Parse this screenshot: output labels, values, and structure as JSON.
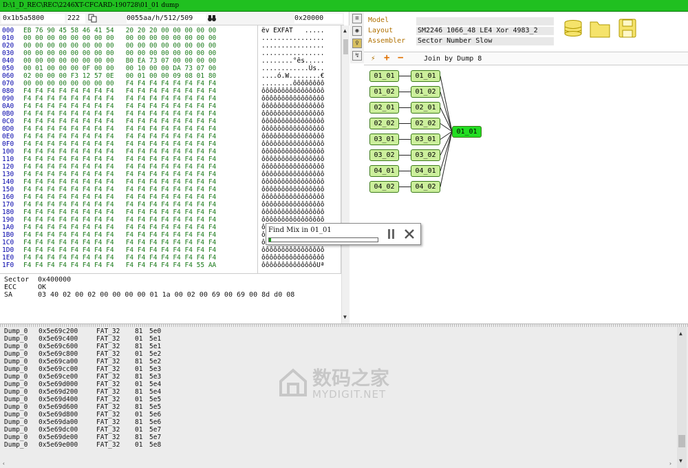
{
  "window": {
    "title": "D:\\1_D_REC\\REC\\2246XT-CFCARD-190728\\01_01 dump"
  },
  "toolbar": {
    "address": "0x1b5a5800",
    "sector_count": "222",
    "page_info": "0055aa/h/512/509",
    "offset_right": "0x20000"
  },
  "hex": {
    "rows": [
      {
        "off": "000",
        "hex": "EB 76 90 45 58 46 41 54   20 20 20 00 00 00 00 00",
        "asc": "ëv EXFAT   ....."
      },
      {
        "off": "010",
        "hex": "00 00 00 00 00 00 00 00   00 00 00 00 00 00 00 00",
        "asc": "................"
      },
      {
        "off": "020",
        "hex": "00 00 00 00 00 00 00 00   00 00 00 00 00 00 00 00",
        "asc": "................"
      },
      {
        "off": "030",
        "hex": "00 00 00 00 00 00 00 00   00 00 00 00 00 00 00 00",
        "asc": "................"
      },
      {
        "off": "040",
        "hex": "00 00 00 00 00 00 00 00   B0 EA 73 07 00 00 00 00",
        "asc": "........°ês....."
      },
      {
        "off": "050",
        "hex": "00 01 00 00 00 0F 00 00   00 10 00 00 DA 73 07 00",
        "asc": "............Ús.."
      },
      {
        "off": "060",
        "hex": "02 00 00 00 F3 12 57 0E   00 01 00 00 09 08 01 80",
        "asc": "....ó.W........€"
      },
      {
        "off": "070",
        "hex": "00 00 00 00 00 00 00 00   F4 F4 F4 F4 F4 F4 F4 F4",
        "asc": "........ôôôôôôôô"
      },
      {
        "off": "080",
        "hex": "F4 F4 F4 F4 F4 F4 F4 F4   F4 F4 F4 F4 F4 F4 F4 F4",
        "asc": "ôôôôôôôôôôôôôôôô"
      },
      {
        "off": "090",
        "hex": "F4 F4 F4 F4 F4 F4 F4 F4   F4 F4 F4 F4 F4 F4 F4 F4",
        "asc": "ôôôôôôôôôôôôôôôô"
      },
      {
        "off": "0A0",
        "hex": "F4 F4 F4 F4 F4 F4 F4 F4   F4 F4 F4 F4 F4 F4 F4 F4",
        "asc": "ôôôôôôôôôôôôôôôô"
      },
      {
        "off": "0B0",
        "hex": "F4 F4 F4 F4 F4 F4 F4 F4   F4 F4 F4 F4 F4 F4 F4 F4",
        "asc": "ôôôôôôôôôôôôôôôô"
      },
      {
        "off": "0C0",
        "hex": "F4 F4 F4 F4 F4 F4 F4 F4   F4 F4 F4 F4 F4 F4 F4 F4",
        "asc": "ôôôôôôôôôôôôôôôô"
      },
      {
        "off": "0D0",
        "hex": "F4 F4 F4 F4 F4 F4 F4 F4   F4 F4 F4 F4 F4 F4 F4 F4",
        "asc": "ôôôôôôôôôôôôôôôô"
      },
      {
        "off": "0E0",
        "hex": "F4 F4 F4 F4 F4 F4 F4 F4   F4 F4 F4 F4 F4 F4 F4 F4",
        "asc": "ôôôôôôôôôôôôôôôô"
      },
      {
        "off": "0F0",
        "hex": "F4 F4 F4 F4 F4 F4 F4 F4   F4 F4 F4 F4 F4 F4 F4 F4",
        "asc": "ôôôôôôôôôôôôôôôô"
      },
      {
        "off": "100",
        "hex": "F4 F4 F4 F4 F4 F4 F4 F4   F4 F4 F4 F4 F4 F4 F4 F4",
        "asc": "ôôôôôôôôôôôôôôôô"
      },
      {
        "off": "110",
        "hex": "F4 F4 F4 F4 F4 F4 F4 F4   F4 F4 F4 F4 F4 F4 F4 F4",
        "asc": "ôôôôôôôôôôôôôôôô"
      },
      {
        "off": "120",
        "hex": "F4 F4 F4 F4 F4 F4 F4 F4   F4 F4 F4 F4 F4 F4 F4 F4",
        "asc": "ôôôôôôôôôôôôôôôô"
      },
      {
        "off": "130",
        "hex": "F4 F4 F4 F4 F4 F4 F4 F4   F4 F4 F4 F4 F4 F4 F4 F4",
        "asc": "ôôôôôôôôôôôôôôôô"
      },
      {
        "off": "140",
        "hex": "F4 F4 F4 F4 F4 F4 F4 F4   F4 F4 F4 F4 F4 F4 F4 F4",
        "asc": "ôôôôôôôôôôôôôôôô"
      },
      {
        "off": "150",
        "hex": "F4 F4 F4 F4 F4 F4 F4 F4   F4 F4 F4 F4 F4 F4 F4 F4",
        "asc": "ôôôôôôôôôôôôôôôô"
      },
      {
        "off": "160",
        "hex": "F4 F4 F4 F4 F4 F4 F4 F4   F4 F4 F4 F4 F4 F4 F4 F4",
        "asc": "ôôôôôôôôôôôôôôôô"
      },
      {
        "off": "170",
        "hex": "F4 F4 F4 F4 F4 F4 F4 F4   F4 F4 F4 F4 F4 F4 F4 F4",
        "asc": "ôôôôôôôôôôôôôôôô"
      },
      {
        "off": "180",
        "hex": "F4 F4 F4 F4 F4 F4 F4 F4   F4 F4 F4 F4 F4 F4 F4 F4",
        "asc": "ôôôôôôôôôôôôôôôô"
      },
      {
        "off": "190",
        "hex": "F4 F4 F4 F4 F4 F4 F4 F4   F4 F4 F4 F4 F4 F4 F4 F4",
        "asc": "ôôôôôôôôôôôôôôôô"
      },
      {
        "off": "1A0",
        "hex": "F4 F4 F4 F4 F4 F4 F4 F4   F4 F4 F4 F4 F4 F4 F4 F4",
        "asc": "ôôôôôôôôôôôôôôôô"
      },
      {
        "off": "1B0",
        "hex": "F4 F4 F4 F4 F4 F4 F4 F4   F4 F4 F4 F4 F4 F4 F4 F4",
        "asc": "ôôôôôôôôôôôôôôôô"
      },
      {
        "off": "1C0",
        "hex": "F4 F4 F4 F4 F4 F4 F4 F4   F4 F4 F4 F4 F4 F4 F4 F4",
        "asc": "ôôôôôôôôôôôôôôôô"
      },
      {
        "off": "1D0",
        "hex": "F4 F4 F4 F4 F4 F4 F4 F4   F4 F4 F4 F4 F4 F4 F4 F4",
        "asc": "ôôôôôôôôôôôôôôôô"
      },
      {
        "off": "1E0",
        "hex": "F4 F4 F4 F4 F4 F4 F4 F4   F4 F4 F4 F4 F4 F4 F4 F4",
        "asc": "ôôôôôôôôôôôôôôôô"
      },
      {
        "off": "1F0",
        "hex": "F4 F4 F4 F4 F4 F4 F4 F4   F4 F4 F4 F4 F4 F4 55 AA",
        "asc": "ôôôôôôôôôôôôôôUª"
      }
    ]
  },
  "info": {
    "sector_label": "Sector",
    "sector_value": "0x400000",
    "ecc_label": "ECC",
    "ecc_value": "OK",
    "sa_label": "SA",
    "sa_value": "03 40 02 00 02 00 00 00 00 01 1a 00 02 00 69 00 69 00 8d d0 08"
  },
  "props": {
    "model_label": "Model",
    "model_value": "",
    "layout_label": "Layout",
    "layout_value": "SM2246 1066_48 LE4 Xor 4983_2",
    "assembler_label": "Assembler",
    "assembler_value": "Sector Number Slow"
  },
  "join": {
    "label": "Join by Dump 8"
  },
  "graph": {
    "left_nodes": [
      "01_01",
      "01_02",
      "02_01",
      "02_02",
      "03_01",
      "03_02",
      "04_01",
      "04_02"
    ],
    "mid_nodes": [
      "01_01",
      "01_02",
      "02_01",
      "02_02",
      "03_01",
      "03_02",
      "04_01",
      "04_02"
    ],
    "result_node": "01_01",
    "result_color": "#22dd22",
    "node_color": "#ccef9c"
  },
  "popup": {
    "label": "Find Mix in 01_01",
    "progress": 0.02
  },
  "log": {
    "rows": [
      {
        "c1": "Dump_0",
        "c2": "0x5e69c200",
        "c3": "FAT_32",
        "c4": "81",
        "c5": "5e0"
      },
      {
        "c1": "Dump_0",
        "c2": "0x5e69c400",
        "c3": "FAT_32",
        "c4": "01",
        "c5": "5e1"
      },
      {
        "c1": "Dump_0",
        "c2": "0x5e69c600",
        "c3": "FAT_32",
        "c4": "81",
        "c5": "5e1"
      },
      {
        "c1": "Dump_0",
        "c2": "0x5e69c800",
        "c3": "FAT_32",
        "c4": "01",
        "c5": "5e2"
      },
      {
        "c1": "Dump_0",
        "c2": "0x5e69ca00",
        "c3": "FAT_32",
        "c4": "81",
        "c5": "5e2"
      },
      {
        "c1": "Dump_0",
        "c2": "0x5e69cc00",
        "c3": "FAT_32",
        "c4": "01",
        "c5": "5e3"
      },
      {
        "c1": "Dump_0",
        "c2": "0x5e69ce00",
        "c3": "FAT_32",
        "c4": "81",
        "c5": "5e3"
      },
      {
        "c1": "Dump_0",
        "c2": "0x5e69d000",
        "c3": "FAT_32",
        "c4": "01",
        "c5": "5e4"
      },
      {
        "c1": "Dump_0",
        "c2": "0x5e69d200",
        "c3": "FAT_32",
        "c4": "81",
        "c5": "5e4"
      },
      {
        "c1": "Dump_0",
        "c2": "0x5e69d400",
        "c3": "FAT_32",
        "c4": "01",
        "c5": "5e5"
      },
      {
        "c1": "Dump_0",
        "c2": "0x5e69d600",
        "c3": "FAT_32",
        "c4": "81",
        "c5": "5e5"
      },
      {
        "c1": "Dump_0",
        "c2": "0x5e69d800",
        "c3": "FAT_32",
        "c4": "01",
        "c5": "5e6"
      },
      {
        "c1": "Dump_0",
        "c2": "0x5e69da00",
        "c3": "FAT_32",
        "c4": "81",
        "c5": "5e6"
      },
      {
        "c1": "Dump_0",
        "c2": "0x5e69dc00",
        "c3": "FAT_32",
        "c4": "01",
        "c5": "5e7"
      },
      {
        "c1": "Dump_0",
        "c2": "0x5e69de00",
        "c3": "FAT_32",
        "c4": "81",
        "c5": "5e7"
      },
      {
        "c1": "Dump_0",
        "c2": "0x5e69e000",
        "c3": "FAT_32",
        "c4": "01",
        "c5": "5e8"
      }
    ]
  },
  "watermark": {
    "cn": "数码之家",
    "en": "MYDIGIT.NET"
  },
  "colors": {
    "titlebar": "#20c020",
    "hex_green": "#1a7a1a",
    "offset_blue": "#0000aa",
    "label_orange": "#b07000"
  }
}
